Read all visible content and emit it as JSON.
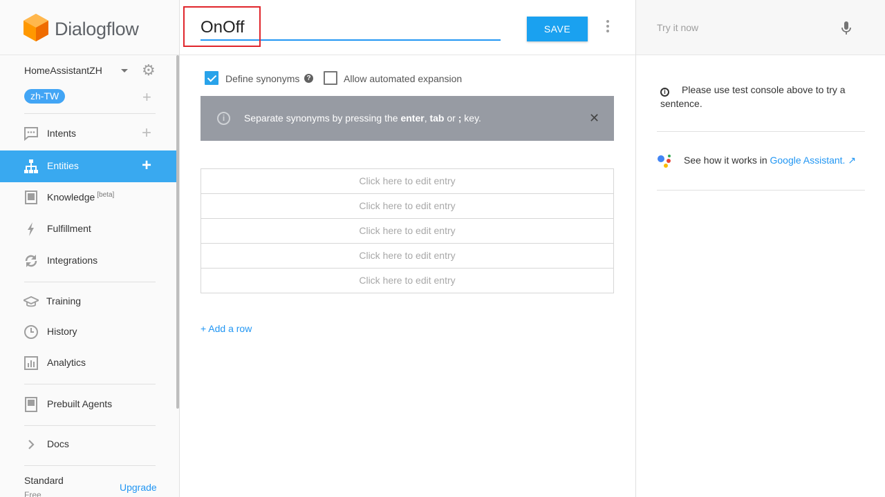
{
  "brand": {
    "name": "Dialogflow"
  },
  "agent": {
    "name": "HomeAssistantZH",
    "language": "zh-TW"
  },
  "nav": [
    {
      "label": "Intents",
      "has_add": true
    },
    {
      "label": "Entities",
      "has_add": true,
      "active": true
    },
    {
      "label": "Knowledge",
      "badge": "[beta]"
    },
    {
      "label": "Fulfillment"
    },
    {
      "label": "Integrations"
    },
    {
      "label": "Training"
    },
    {
      "label": "History"
    },
    {
      "label": "Analytics"
    },
    {
      "label": "Prebuilt Agents"
    },
    {
      "label": "Docs"
    }
  ],
  "plan": {
    "name": "Standard",
    "tier": "Free",
    "upgrade_label": "Upgrade"
  },
  "entity": {
    "name": "OnOff",
    "save_label": "SAVE",
    "define_synonyms": {
      "label": "Define synonyms",
      "checked": true
    },
    "auto_expansion": {
      "label": "Allow automated expansion",
      "checked": false
    },
    "info": {
      "prefix": "Separate synonyms by pressing the ",
      "key1": "enter",
      "sep1": ", ",
      "key2": "tab",
      "sep2": " or ",
      "key3": ";",
      "suffix": " key."
    },
    "entries": [
      "Click here to edit entry",
      "Click here to edit entry",
      "Click here to edit entry",
      "Click here to edit entry",
      "Click here to edit entry"
    ],
    "add_row_label": "+ Add a row"
  },
  "console": {
    "placeholder": "Try it now",
    "note": "Please use test console above to try a sentence.",
    "assistant_prefix": "See how it works in ",
    "assistant_link": "Google Assistant."
  },
  "colors": {
    "accent": "#39a9f0",
    "highlight": "#e0252b",
    "info_bar": "#979ba3"
  }
}
